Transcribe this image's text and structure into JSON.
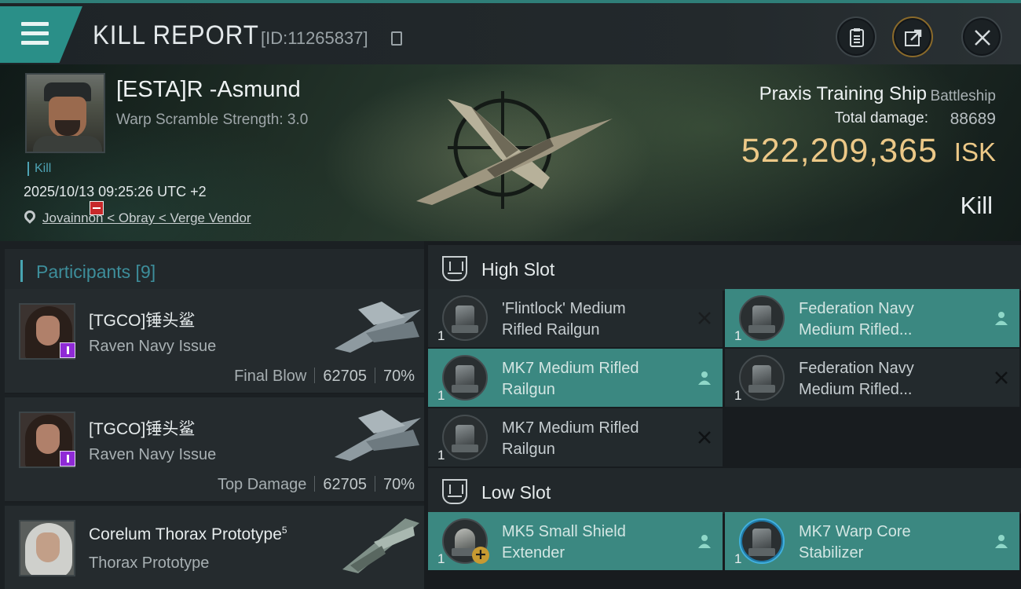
{
  "header": {
    "title": "KILL REPORT",
    "report_id": "[ID:11265837]"
  },
  "victim": {
    "name": "[ESTA]R -Asmund",
    "warp_scramble": "Warp Scramble Strength: 3.0",
    "tag": "Kill",
    "datetime": "2025/10/13 09:25:26 UTC +2",
    "location": "Jovainnon < Obray < Verge Vendor",
    "ship_name": "Praxis Training Ship",
    "ship_class": "Battleship",
    "total_damage_label": "Total damage:",
    "total_damage": "88689",
    "isk_value": "522,209,365",
    "isk_unit": "ISK",
    "result": "Kill"
  },
  "participants": {
    "title": "Participants [9]",
    "items": [
      {
        "name": "[TGCO]锤头鲨",
        "ship": "Raven Navy Issue",
        "role": "Final Blow",
        "damage": "62705",
        "percent": "70%"
      },
      {
        "name": "[TGCO]锤头鲨",
        "ship": "Raven Navy Issue",
        "role": "Top Damage",
        "damage": "62705",
        "percent": "70%"
      },
      {
        "name": "Corelum Thorax Prototype",
        "sup": "5",
        "ship": "Thorax Prototype"
      }
    ]
  },
  "high_slot": {
    "title": "High Slot",
    "modules": [
      {
        "qty": "1",
        "line1": "'Flintlock' Medium",
        "line2": "Rifled Railgun",
        "status": "destroyed"
      },
      {
        "qty": "1",
        "line1": "Federation Navy",
        "line2": "Medium Rifled...",
        "status": "dropped"
      },
      {
        "qty": "1",
        "line1": "MK7 Medium Rifled",
        "line2": "Railgun",
        "status": "dropped"
      },
      {
        "qty": "1",
        "line1": "Federation Navy",
        "line2": "Medium Rifled...",
        "status": "destroyed"
      },
      {
        "qty": "1",
        "line1": "MK7 Medium Rifled",
        "line2": "Railgun",
        "status": "destroyed"
      }
    ]
  },
  "low_slot": {
    "title": "Low Slot",
    "modules": [
      {
        "qty": "1",
        "line1": "MK5 Small Shield",
        "line2": "Extender",
        "status": "dropped"
      },
      {
        "qty": "1",
        "line1": "MK7 Warp Core",
        "line2": "Stabilizer",
        "status": "dropped"
      }
    ]
  },
  "colors": {
    "accent_teal": "#3b8881",
    "isk_gold": "#ecc887",
    "participants_blue": "#3d8e9b"
  }
}
